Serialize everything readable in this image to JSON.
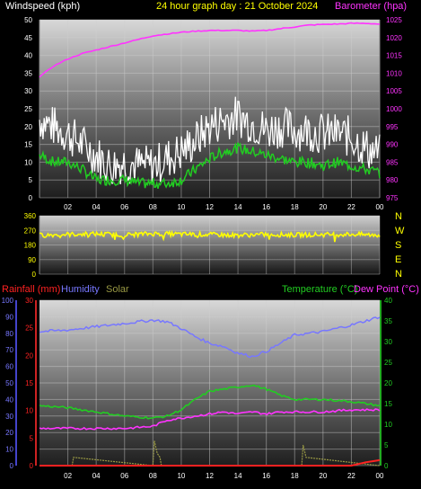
{
  "chart_data": [
    {
      "type": "line",
      "title": "24 hour graph day : 21 October 2024",
      "ylabel_left": "Windspeed (kph)",
      "ylabel_right": "Barometer (hpa)",
      "x_ticks": [
        "02",
        "04",
        "06",
        "08",
        "10",
        "12",
        "14",
        "16",
        "18",
        "20",
        "22",
        "00"
      ],
      "y_left_ticks": [
        "0",
        "5",
        "10",
        "15",
        "20",
        "25",
        "30",
        "35",
        "40",
        "45",
        "50"
      ],
      "y_right_ticks": [
        "975",
        "980",
        "985",
        "990",
        "995",
        "1000",
        "1005",
        "1010",
        "1015",
        "1020",
        "1025"
      ],
      "ylim_left": [
        0,
        50
      ],
      "ylim_right": [
        975,
        1025
      ],
      "colors": {
        "gust": "#ffffff",
        "average": "#22cc22",
        "barometer": "#ff33ff",
        "title": "#ffff00",
        "ylabel_left": "#ffffff",
        "ylabel_right": "#ff33ff"
      },
      "series": [
        {
          "key": "gust",
          "hours": [
            0,
            1,
            2,
            3,
            4,
            5,
            6,
            7,
            8,
            9,
            10,
            11,
            12,
            13,
            14,
            15,
            16,
            17,
            18,
            19,
            20,
            21,
            22,
            23,
            24
          ],
          "values": [
            22,
            20,
            18,
            15,
            12,
            9,
            10,
            9,
            9,
            11,
            13,
            16,
            20,
            22,
            23,
            21,
            19,
            20,
            19,
            19,
            18,
            18,
            17,
            14,
            12
          ]
        },
        {
          "key": "average",
          "hours": [
            0,
            1,
            2,
            3,
            4,
            5,
            6,
            7,
            8,
            9,
            10,
            11,
            12,
            13,
            14,
            15,
            16,
            17,
            18,
            19,
            20,
            21,
            22,
            23,
            24
          ],
          "values": [
            12,
            10,
            10,
            8,
            5,
            5,
            5,
            4,
            4,
            4,
            5,
            8,
            11,
            13,
            14,
            13,
            12,
            11,
            10,
            10,
            9,
            10,
            9,
            8,
            7
          ]
        },
        {
          "key": "barometer",
          "hours": [
            0,
            1,
            2,
            3,
            4,
            5,
            6,
            7,
            8,
            9,
            10,
            11,
            12,
            13,
            14,
            15,
            16,
            17,
            18,
            19,
            20,
            21,
            22,
            23,
            24
          ],
          "values": [
            1009,
            1012,
            1014,
            1015.5,
            1016.5,
            1017.5,
            1018.5,
            1019.5,
            1020.5,
            1021,
            1021.5,
            1021.8,
            1022,
            1022,
            1022,
            1021.8,
            1022,
            1022.5,
            1023,
            1023.5,
            1023.7,
            1023.8,
            1024,
            1024,
            1023.8
          ]
        }
      ]
    },
    {
      "type": "line",
      "y_left_ticks": [
        "360",
        "270",
        "180",
        "90",
        "0"
      ],
      "compass_labels": [
        "N",
        "W",
        "S",
        "E",
        "N"
      ],
      "ylim": [
        0,
        360
      ],
      "colors": {
        "direction": "#ffff00",
        "compass": "#ffff00"
      },
      "series": [
        {
          "key": "direction",
          "hours": [
            0,
            2,
            4,
            6,
            8,
            10,
            12,
            14,
            16,
            18,
            20,
            22,
            24
          ],
          "values": [
            240,
            245,
            248,
            242,
            250,
            246,
            244,
            240,
            245,
            242,
            244,
            246,
            240
          ]
        }
      ]
    },
    {
      "type": "line",
      "labels": {
        "rainfall": "Rainfall (mm)",
        "humidity": "Humidity",
        "solar": "Solar",
        "temperature": "Temperature (°C)",
        "dewpoint": "Dew Point (°C)"
      },
      "colors": {
        "rainfall": "#ff2222",
        "humidity": "#7777ff",
        "solar": "#999944",
        "temperature": "#22cc22",
        "dewpoint": "#ff33ff"
      },
      "x_ticks": [
        "02",
        "04",
        "06",
        "08",
        "10",
        "12",
        "14",
        "16",
        "18",
        "20",
        "22",
        "00"
      ],
      "humidity_ticks": [
        "0",
        "10",
        "20",
        "30",
        "40",
        "50",
        "60",
        "70",
        "80",
        "90",
        "100"
      ],
      "rainfall_ticks": [
        "0",
        "5",
        "10",
        "15",
        "20",
        "25",
        "30"
      ],
      "temperature_ticks": [
        "0",
        "5",
        "10",
        "15",
        "20",
        "25",
        "30",
        "35",
        "40"
      ],
      "ylim_humidity": [
        0,
        100
      ],
      "ylim_rainfall": [
        0,
        30
      ],
      "ylim_temperature": [
        0,
        40
      ],
      "series": [
        {
          "key": "humidity",
          "hours": [
            0,
            2,
            4,
            6,
            8,
            9,
            10,
            11,
            12,
            13,
            14,
            15,
            16,
            17,
            18,
            20,
            22,
            24
          ],
          "values": [
            81,
            82,
            84,
            86,
            88,
            87,
            83,
            78,
            74,
            72,
            68,
            66,
            69,
            74,
            79,
            81,
            85,
            90
          ]
        },
        {
          "key": "temperature",
          "hours": [
            0,
            2,
            4,
            6,
            8,
            9,
            10,
            11,
            12,
            13,
            14,
            15,
            16,
            17,
            18,
            20,
            22,
            24
          ],
          "values": [
            14.5,
            14,
            13,
            12,
            11.5,
            12,
            13.5,
            16,
            18,
            18.5,
            19,
            19.5,
            18.5,
            17,
            16,
            16,
            15.5,
            14.5
          ]
        },
        {
          "key": "dewpoint",
          "hours": [
            0,
            2,
            4,
            6,
            8,
            9,
            10,
            11,
            12,
            13,
            14,
            15,
            16,
            17,
            18,
            20,
            22,
            24
          ],
          "values": [
            9,
            9,
            9,
            9,
            9.5,
            11,
            11.5,
            12,
            12.5,
            13,
            12.5,
            13,
            12.5,
            13,
            13,
            13,
            13.5,
            13.5
          ]
        },
        {
          "key": "rainfall",
          "hours": [
            0,
            22,
            22.5,
            23,
            23.5,
            24
          ],
          "values": [
            0,
            0,
            0.3,
            0.6,
            0.8,
            1.0
          ]
        },
        {
          "key": "solar",
          "hours": [
            0,
            2.3,
            2.4,
            8,
            8.1,
            8.3,
            8.5,
            8.6,
            18.5,
            18.6,
            18.8,
            24
          ],
          "values": [
            0,
            0,
            2,
            0,
            6,
            3,
            2,
            0,
            0,
            5,
            2,
            0
          ]
        }
      ]
    }
  ]
}
